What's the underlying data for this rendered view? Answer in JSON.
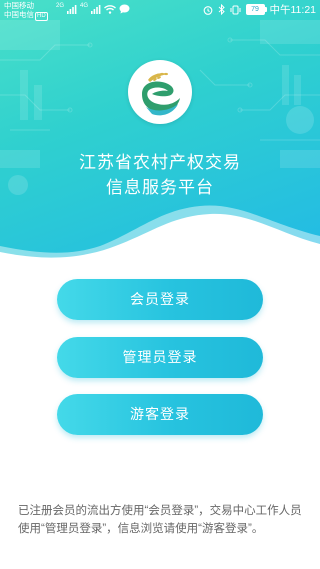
{
  "status_bar": {
    "carrier_1": "中国移动",
    "carrier_2": "中国电信",
    "carrier_2_badge": "HD",
    "network_1": "2G",
    "network_2": "4G",
    "battery": "79",
    "time": "中午11:21",
    "icons": [
      "signal-icon",
      "wifi-icon",
      "chat-icon",
      "alarm-icon",
      "bluetooth-icon",
      "vibrate-icon",
      "battery-icon"
    ]
  },
  "header": {
    "title_line1": "江苏省农村产权交易",
    "title_line2": "信息服务平台",
    "logo_icon": "wheat-logo-icon",
    "gradient_colors": [
      "#49e0c8",
      "#22b9e6"
    ]
  },
  "buttons": {
    "member_login": "会员登录",
    "admin_login": "管理员登录",
    "guest_login": "游客登录"
  },
  "footer": {
    "note": "已注册会员的流出方使用“会员登录”，交易中心工作人员使用“管理员登录”，信息浏览请使用“游客登录”。"
  },
  "colors": {
    "button_start": "#44d9e9",
    "button_end": "#1fb9d9",
    "text_gray": "#666666",
    "logo_green": "#2f9e6d",
    "logo_gold": "#d9b64a"
  }
}
